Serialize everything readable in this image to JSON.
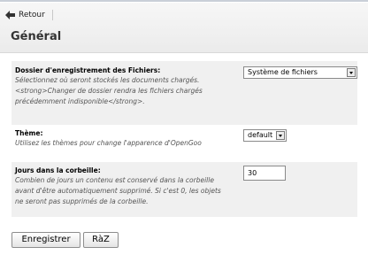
{
  "header": {
    "back_label": "Retour",
    "title": "Général"
  },
  "settings": [
    {
      "label": "Dossier d'enregistrement des Fichiers:",
      "description_lines": [
        "Sélectionnez où seront stockés les documents chargés.",
        "<strong>Changer de dossier rendra les fichiers chargés",
        "précédemment indisponible</strong>."
      ],
      "control": "select",
      "value": "Système de fichiers"
    },
    {
      "label": "Thème:",
      "description_lines": [
        "Utilisez les thèmes pour change l'apparence d'OpenGoo"
      ],
      "control": "select",
      "value": "default"
    },
    {
      "label": "Jours dans la corbeille:",
      "description_lines": [
        "Combien de jours un contenu est conservé dans la corbeille",
        "avant d'être automatiquement supprimé. Si c'est 0, les objets",
        "ne seront pas supprimés de la corbeille."
      ],
      "control": "text",
      "value": "30"
    }
  ],
  "buttons": {
    "save_label": "Enregistrer",
    "reset_label": "RàZ"
  },
  "colors": {
    "row_background": "#f0f0f0",
    "header_background": "#ebebeb"
  },
  "icons": {
    "back": "arrow-left-icon",
    "dropdown": "chevron-down-icon"
  }
}
